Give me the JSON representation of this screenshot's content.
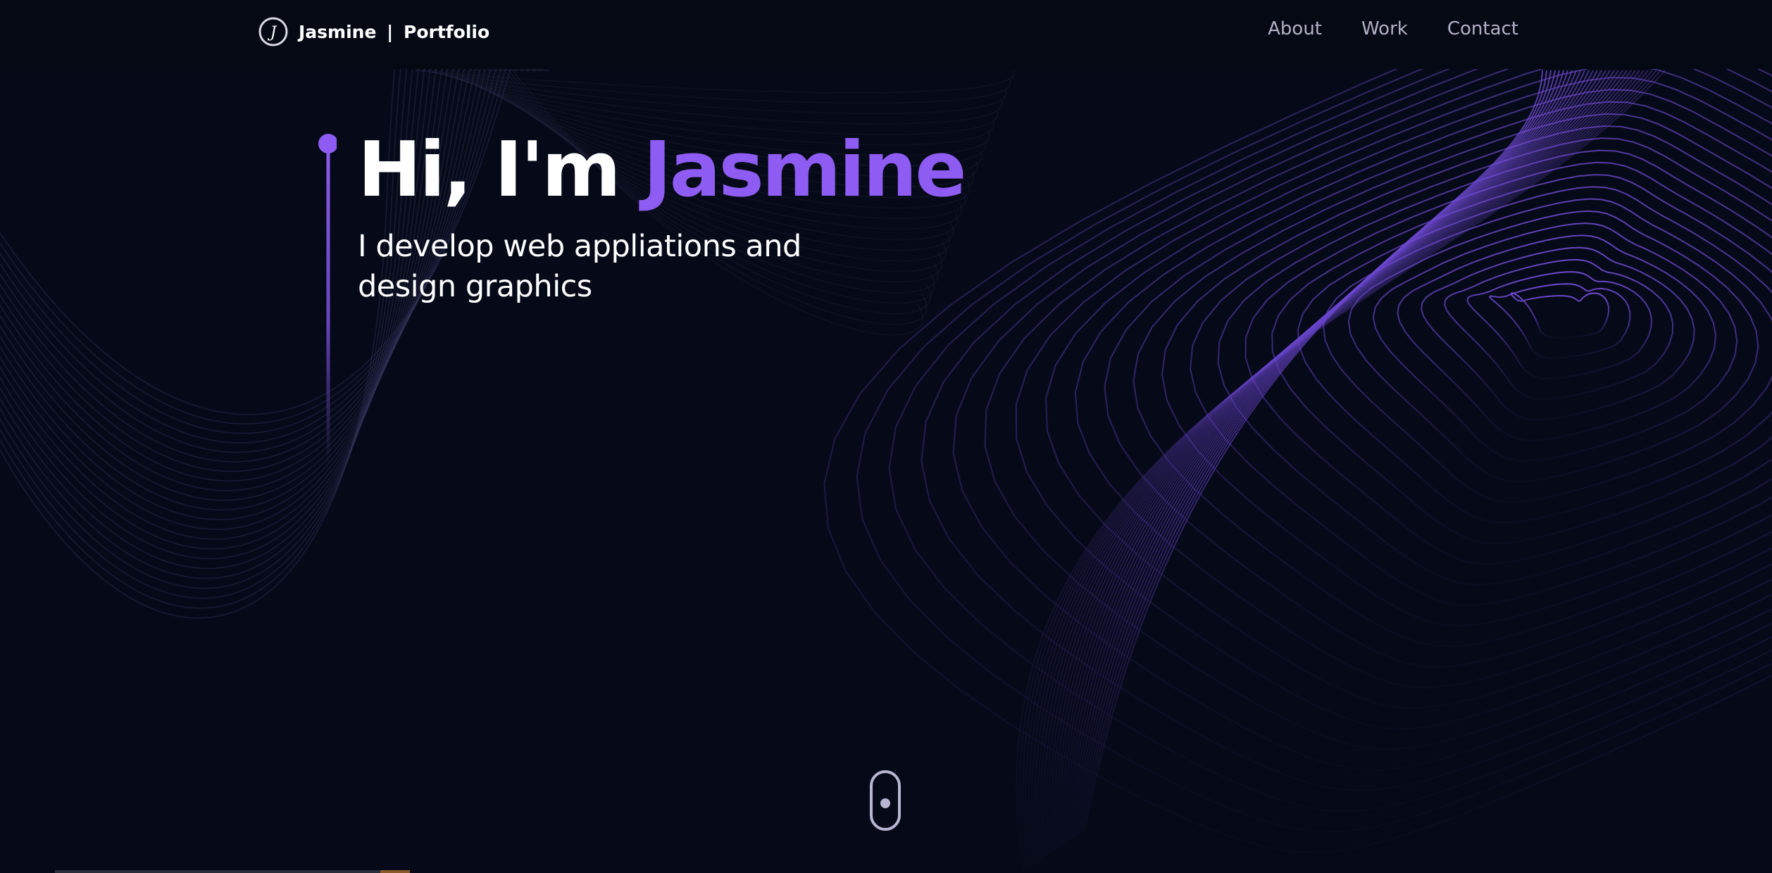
{
  "header": {
    "logo_letter": "J",
    "brand_name": "Jasmine",
    "brand_separator": "|",
    "brand_suffix": "Portfolio",
    "nav": [
      {
        "label": "About"
      },
      {
        "label": "Work"
      },
      {
        "label": "Contact"
      }
    ]
  },
  "hero": {
    "greeting": "Hi, I'm ",
    "name": "Jasmine",
    "subtitle": "I develop web appliations and design graphics"
  },
  "theme": {
    "background": "#060a18",
    "accent": "#8e5cf2",
    "nav_text": "#b4b0c8"
  },
  "icons": {
    "logo": "circle-j-logo-icon",
    "scroll": "mouse-scroll-icon"
  }
}
